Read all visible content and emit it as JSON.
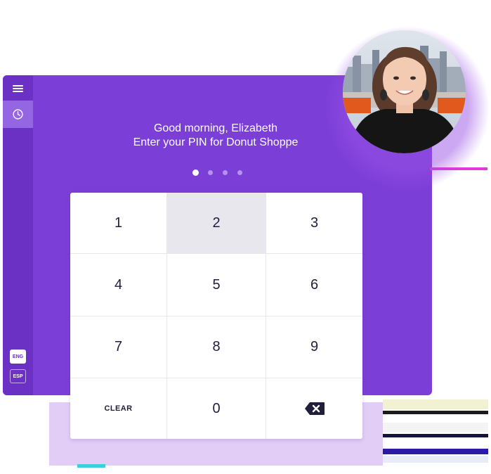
{
  "greeting": {
    "line1": "Good morning, Elizabeth",
    "line2": "Enter your PIN for Donut Shoppe"
  },
  "pin": {
    "total_dots": 4,
    "entered": 1
  },
  "keypad": {
    "keys": [
      "1",
      "2",
      "3",
      "4",
      "5",
      "6",
      "7",
      "8",
      "9",
      "CLEAR",
      "0"
    ],
    "pressed_key": "2",
    "backspace_icon": "backspace-icon"
  },
  "sidebar": {
    "menu_icon": "hamburger-menu-icon",
    "clock_icon": "clock-icon",
    "languages": [
      "ENG",
      "ESP"
    ],
    "active_language": "ENG"
  },
  "colors": {
    "panel": "#7b3fd8",
    "sidebar": "#6b30c4",
    "key_text": "#1f1f3d"
  }
}
